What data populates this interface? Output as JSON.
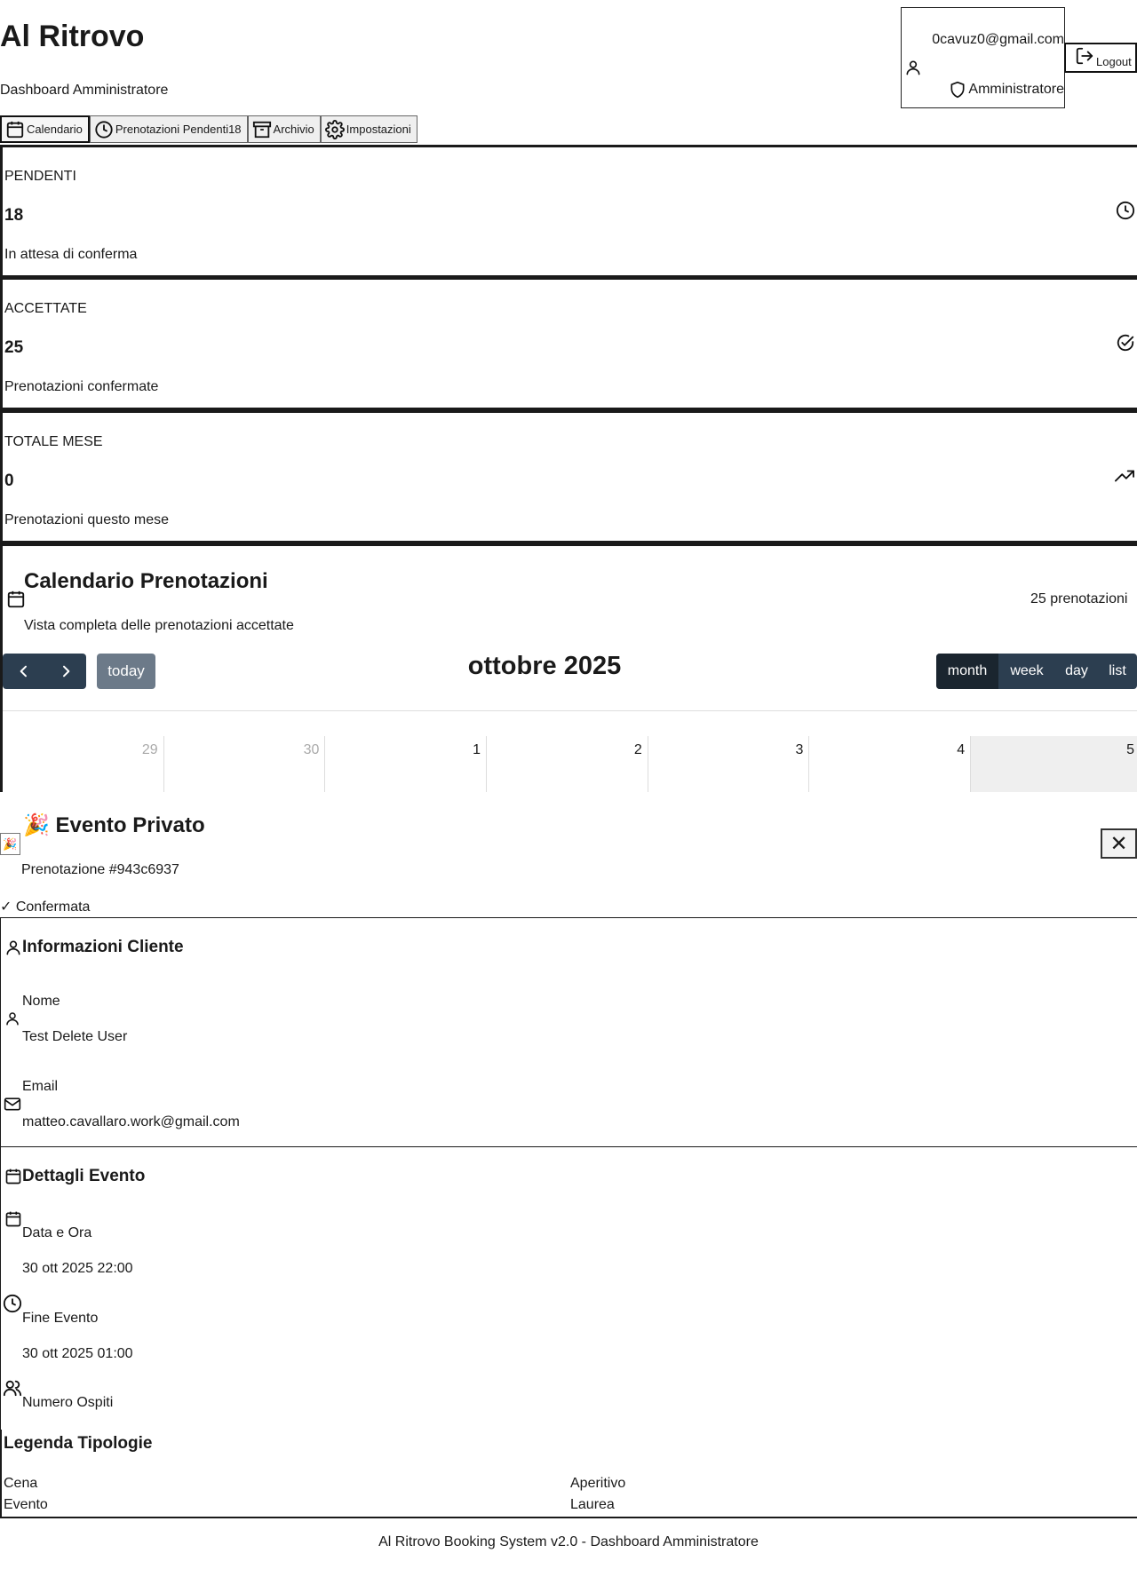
{
  "app": {
    "title": "Al Ritrovo",
    "subtitle": "Dashboard Amministratore"
  },
  "user": {
    "email": "0cavuz0@gmail.com",
    "role": "Amministratore",
    "logout_label": "Logout"
  },
  "tabs": [
    {
      "label": "Calendario",
      "icon": "calendar-icon",
      "active": true
    },
    {
      "label": "Prenotazioni Pendenti18",
      "icon": "clock-icon",
      "active": false
    },
    {
      "label": "Archivio",
      "icon": "archive-icon",
      "active": false
    },
    {
      "label": "Impostazioni",
      "icon": "gear-icon",
      "active": false
    }
  ],
  "stats": [
    {
      "label": "PENDENTI",
      "value": "18",
      "description": "In attesa di conferma",
      "icon": "clock-icon"
    },
    {
      "label": "ACCETTATE",
      "value": "25",
      "description": "Prenotazioni confermate",
      "icon": "check-circle-icon"
    },
    {
      "label": "TOTALE MESE",
      "value": "0",
      "description": "Prenotazioni questo mese",
      "icon": "trending-up-icon"
    }
  ],
  "calendar": {
    "title": "Calendario Prenotazioni",
    "subtitle": "Vista completa delle prenotazioni accettate",
    "count": "25 prenotazioni",
    "today_label": "today",
    "month_title": "ottobre 2025",
    "views": [
      {
        "label": "month",
        "active": true
      },
      {
        "label": "week",
        "active": false
      },
      {
        "label": "day",
        "active": false
      },
      {
        "label": "list",
        "active": false
      }
    ],
    "days": [
      {
        "num": "29",
        "state": "other"
      },
      {
        "num": "30",
        "state": "other"
      },
      {
        "num": "1",
        "state": "current"
      },
      {
        "num": "2",
        "state": "current"
      },
      {
        "num": "3",
        "state": "current"
      },
      {
        "num": "4",
        "state": "current"
      },
      {
        "num": "5",
        "state": "today"
      }
    ]
  },
  "modal": {
    "emoji": "🎉",
    "title": "🎉 Evento Privato",
    "close_label": "✕",
    "booking_id": "Prenotazione #943c6937",
    "status": "✓ Confermata",
    "client": {
      "title": "Informazioni Cliente",
      "name_label": "Nome",
      "name_value": "Test Delete User",
      "email_label": "Email",
      "email_value": "matteo.cavallaro.work@gmail.com"
    },
    "event": {
      "title": "Dettagli Evento",
      "date_label": "Data e Ora",
      "date_value": "30 ott 2025 22:00",
      "end_label": "Fine Evento",
      "end_value": "30 ott 2025 01:00",
      "guests_label": "Numero Ospiti"
    }
  },
  "legend": {
    "title": "Legenda Tipologie",
    "items": [
      "Cena",
      "Aperitivo",
      "Evento",
      "Laurea"
    ]
  },
  "footer": {
    "text": "Al Ritrovo Booking System v2.0 - Dashboard Amministratore"
  }
}
